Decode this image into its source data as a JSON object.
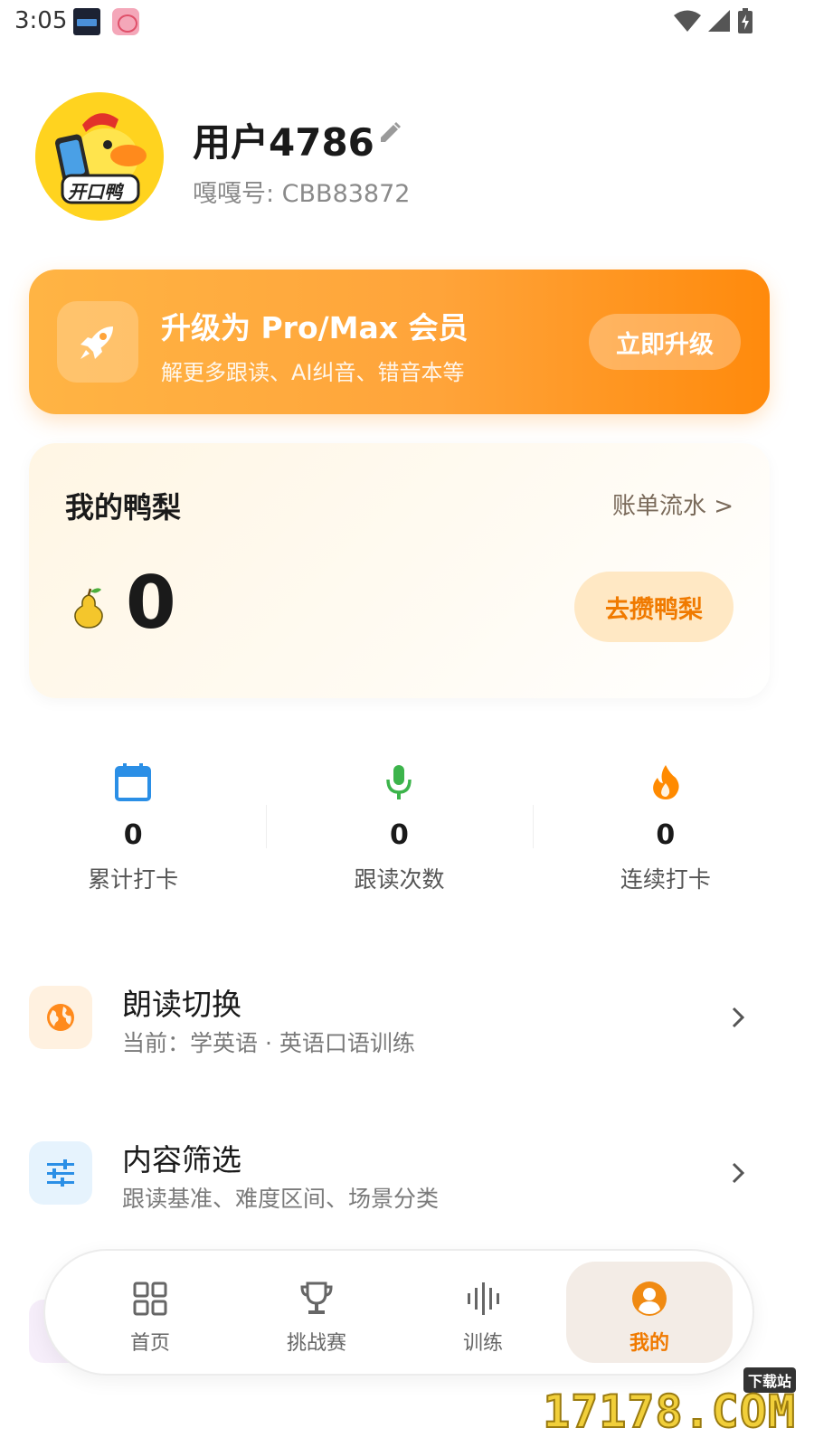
{
  "status_bar": {
    "time": "3:05"
  },
  "profile": {
    "username": "用户4786",
    "user_id": "嘎嘎号: CBB83872",
    "avatar_text": "开口鸭"
  },
  "upgrade": {
    "title": "升级为 Pro/Max 会员",
    "subtitle": "解更多跟读、AI纠音、错音本等",
    "button": "立即升级"
  },
  "pear": {
    "title": "我的鸭梨",
    "bill_link": "账单流水 >",
    "count": "0",
    "earn_button": "去攒鸭梨"
  },
  "stats": [
    {
      "value": "0",
      "label": "累计打卡",
      "icon": "calendar-icon",
      "color": "#2b8fe6"
    },
    {
      "value": "0",
      "label": "跟读次数",
      "icon": "microphone-icon",
      "color": "#3cb44b"
    },
    {
      "value": "0",
      "label": "连续打卡",
      "icon": "flame-icon",
      "color": "#ff8a00"
    }
  ],
  "settings": [
    {
      "title": "朗读切换",
      "subtitle": "当前：学英语 · 英语口语训练",
      "icon": "globe-icon"
    },
    {
      "title": "内容筛选",
      "subtitle": "跟读基准、难度区间、场景分类",
      "icon": "sliders-icon"
    }
  ],
  "nav": [
    {
      "label": "首页",
      "icon": "grid-icon"
    },
    {
      "label": "挑战赛",
      "icon": "trophy-icon"
    },
    {
      "label": "训练",
      "icon": "waveform-icon"
    },
    {
      "label": "我的",
      "icon": "user-icon",
      "active": true
    }
  ],
  "watermark": {
    "text": "17178.COM",
    "tag": "下载站"
  }
}
